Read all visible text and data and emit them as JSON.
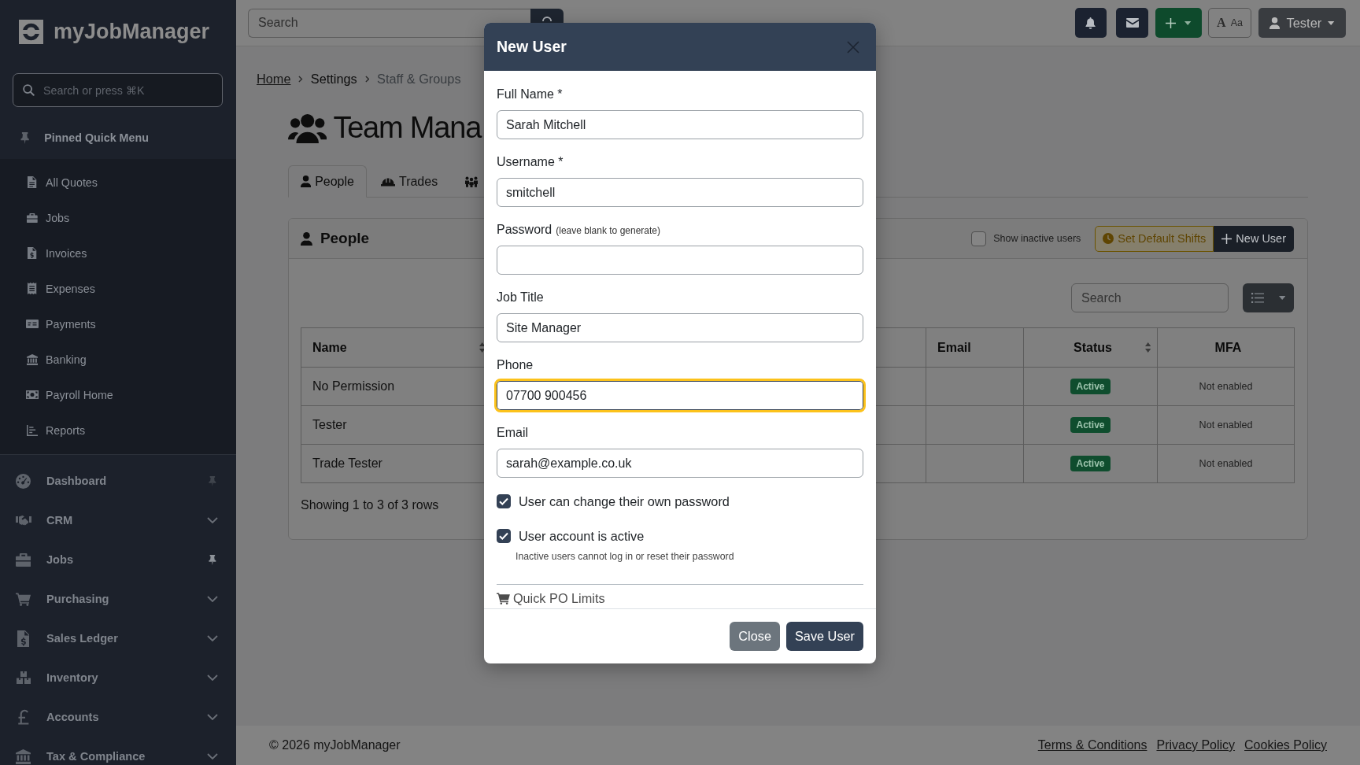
{
  "sidebar": {
    "brand": "myJobManager",
    "search": {
      "placeholder": "Search or press ⌘K"
    },
    "pinned_menu": {
      "title": "Pinned Quick Menu",
      "items": [
        "All Quotes",
        "Jobs",
        "Invoices",
        "Expenses",
        "Payments",
        "Banking",
        "Payroll Home",
        "Reports"
      ]
    },
    "nav": [
      {
        "label": "Dashboard",
        "kind": "pinnable",
        "pinned": false
      },
      {
        "label": "CRM",
        "kind": "group",
        "expanded": false
      },
      {
        "label": "Jobs",
        "kind": "pinnable",
        "pinned": true
      },
      {
        "label": "Purchasing",
        "kind": "group",
        "expanded": false
      },
      {
        "label": "Sales Ledger",
        "kind": "group",
        "expanded": false
      },
      {
        "label": "Inventory",
        "kind": "group",
        "expanded": false
      },
      {
        "label": "Accounts",
        "kind": "group",
        "expanded": false
      },
      {
        "label": "Tax & Compliance",
        "kind": "group",
        "expanded": false
      }
    ]
  },
  "topbar": {
    "search": {
      "placeholder": "Search"
    },
    "font_toggle": {
      "large": "A",
      "small": "Aa"
    },
    "user": "Tester"
  },
  "breadcrumb": [
    {
      "label": "Home",
      "kind": "link"
    },
    {
      "label": "Settings",
      "kind": "section"
    },
    {
      "label": "Staff & Groups",
      "kind": "current"
    }
  ],
  "page_title": "Team Mana",
  "tabs": [
    {
      "label": "People",
      "selected": true
    },
    {
      "label": "Trades",
      "selected": false
    },
    {
      "selected": false
    }
  ],
  "card": {
    "title": "People",
    "show_inactive": {
      "label": "Show inactive users",
      "checked": false
    },
    "buttons": [
      {
        "label": "Set Default Shifts",
        "kind": "outline"
      },
      {
        "label": "New User",
        "kind": "dark"
      }
    ],
    "search": {
      "placeholder": "Search"
    },
    "table": {
      "columns": [
        {
          "label": "Name",
          "sortable": true
        },
        {
          "label": "Email",
          "sortable": false
        },
        {
          "label": "Status",
          "sortable": true
        },
        {
          "label": "MFA",
          "sortable": false
        }
      ],
      "rows": [
        {
          "name": "No Permission",
          "status": "Active",
          "mfa": "Not enabled"
        },
        {
          "name": "Tester",
          "status": "Active",
          "mfa": "Not enabled"
        },
        {
          "name": "Trade Tester",
          "status": "Active",
          "mfa": "Not enabled"
        }
      ]
    },
    "summary": "Showing 1 to 3 of 3 rows"
  },
  "modal": {
    "title": "New User",
    "fields": [
      {
        "label": "Full Name *",
        "value": "Sarah Mitchell",
        "focused": false
      },
      {
        "label": "Username *",
        "value": "smitchell",
        "focused": false
      },
      {
        "label": "Password",
        "hint": "(leave blank to generate)",
        "focused": false
      },
      {
        "label": "Job Title",
        "value": "Site Manager",
        "focused": false
      },
      {
        "label": "Phone",
        "value": "07700 900456",
        "focused": true
      },
      {
        "label": "Email",
        "value": "sarah@example.co.uk",
        "focused": false
      }
    ],
    "checkboxes": [
      {
        "label": "User can change their own password",
        "checked": true
      },
      {
        "label": "User account is active",
        "checked": true,
        "help": "Inactive users cannot log in or reset their password"
      }
    ],
    "section": "Quick PO Limits",
    "buttons": [
      {
        "label": "Close",
        "kind": "secondary"
      },
      {
        "label": "Save User",
        "kind": "primary"
      }
    ]
  },
  "footer": {
    "copyright": "© 2026 myJobManager",
    "links": [
      "Terms & Conditions",
      "Privacy Policy",
      "Cookies Policy"
    ]
  }
}
